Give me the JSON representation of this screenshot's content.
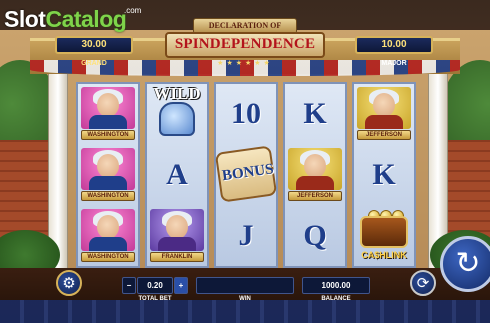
{
  "brand": {
    "logo_slot": "Slot",
    "logo_catalog": "Catalog",
    "logo_com": ".com"
  },
  "game": {
    "title_top": "DECLARATION OF",
    "title_main": "SPINDEPENDENCE",
    "stars": "★★★★★★"
  },
  "jackpots": {
    "grand": {
      "value": "30.00",
      "label": "GRAND"
    },
    "major": {
      "value": "10.00",
      "label": "MAJOR"
    }
  },
  "reels": [
    {
      "symbols": [
        {
          "type": "portrait",
          "name": "WASHINGTON",
          "bg": "pink",
          "coat": "blue"
        },
        {
          "type": "portrait",
          "name": "WASHINGTON",
          "bg": "pink",
          "coat": "blue"
        },
        {
          "type": "portrait",
          "name": "WASHINGTON",
          "bg": "pink",
          "coat": "blue"
        }
      ]
    },
    {
      "symbols": [
        {
          "type": "wild",
          "label": "WILD",
          "icon": "liberty-bell-icon"
        },
        {
          "type": "card",
          "label": "A"
        },
        {
          "type": "portrait",
          "name": "FRANKLIN",
          "bg": "purple",
          "coat": "purple"
        }
      ]
    },
    {
      "symbols": [
        {
          "type": "card",
          "label": "10"
        },
        {
          "type": "bonus",
          "label": "BONUS",
          "icon": "scroll-icon"
        },
        {
          "type": "card",
          "label": "J"
        }
      ]
    },
    {
      "symbols": [
        {
          "type": "card",
          "label": "K"
        },
        {
          "type": "portrait",
          "name": "JEFFERSON",
          "bg": "yellow",
          "coat": "red"
        },
        {
          "type": "card",
          "label": "Q"
        }
      ]
    },
    {
      "symbols": [
        {
          "type": "portrait",
          "name": "JEFFERSON",
          "bg": "yellow",
          "coat": "red"
        },
        {
          "type": "card",
          "label": "K"
        },
        {
          "type": "cashlink",
          "label": "CA$HLINK",
          "icon": "treasure-chest-icon"
        }
      ]
    }
  ],
  "controls": {
    "settings_icon": "⚙",
    "bet_minus": "−",
    "bet_value": "0.20",
    "bet_plus": "+",
    "bet_label": "TOTAL BET",
    "win_value": "",
    "win_label": "WIN",
    "balance_value": "1000.00",
    "balance_label": "BALANCE",
    "autoplay_icon": "⟳",
    "spin_icon": "↻"
  },
  "colors": {
    "accent_gold": "#d6b25a",
    "title_red": "#b3141b",
    "navy": "#1f3e8a"
  }
}
